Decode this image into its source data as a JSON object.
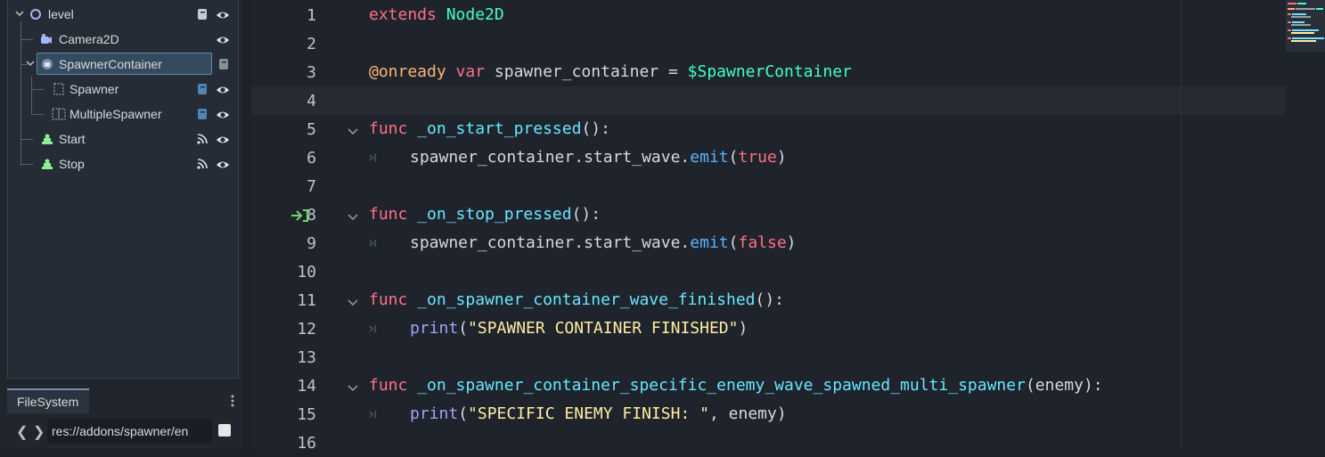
{
  "scene_tree": {
    "nodes": [
      {
        "label": "level",
        "icon": "node2d-circle-icon"
      },
      {
        "label": "Camera2D",
        "icon": "camera2d-icon"
      },
      {
        "label": "SpawnerContainer",
        "icon": "spawner-container-icon"
      },
      {
        "label": "Spawner",
        "icon": "spawner-icon"
      },
      {
        "label": "MultipleSpawner",
        "icon": "multiple-spawner-icon"
      },
      {
        "label": "Start",
        "icon": "button-node-icon"
      },
      {
        "label": "Stop",
        "icon": "button-node-icon"
      }
    ]
  },
  "filesystem": {
    "tab_label": "FileSystem",
    "path_value": "res://addons/spawner/en",
    "back_glyph": "❮",
    "forward_glyph": "❯"
  },
  "editor": {
    "lines": [
      {
        "n": "1",
        "tokens": [
          [
            "kw",
            "extends"
          ],
          [
            "p",
            " "
          ],
          [
            "cls",
            "Node2D"
          ]
        ]
      },
      {
        "n": "2",
        "tokens": []
      },
      {
        "n": "3",
        "tokens": [
          [
            "ann",
            "@onready"
          ],
          [
            "p",
            " "
          ],
          [
            "kw",
            "var"
          ],
          [
            "p",
            " spawner_container = "
          ],
          [
            "cls",
            "$SpawnerContainer"
          ]
        ]
      },
      {
        "n": "4",
        "tokens": []
      },
      {
        "n": "5",
        "tokens": [
          [
            "kw",
            "func"
          ],
          [
            "p",
            " "
          ],
          [
            "fnd",
            "_on_start_pressed"
          ],
          [
            "p",
            "():"
          ]
        ]
      },
      {
        "n": "6",
        "tokens": [
          [
            "p",
            "spawner_container.start_wave."
          ],
          [
            "fn",
            "emit"
          ],
          [
            "p",
            "("
          ],
          [
            "kw",
            "true"
          ],
          [
            "p",
            ")"
          ]
        ]
      },
      {
        "n": "7",
        "tokens": []
      },
      {
        "n": "8",
        "tokens": [
          [
            "kw",
            "func"
          ],
          [
            "p",
            " "
          ],
          [
            "fnd",
            "_on_stop_pressed"
          ],
          [
            "p",
            "():"
          ]
        ]
      },
      {
        "n": "9",
        "tokens": [
          [
            "p",
            "spawner_container.start_wave."
          ],
          [
            "fn",
            "emit"
          ],
          [
            "p",
            "("
          ],
          [
            "kw",
            "false"
          ],
          [
            "p",
            ")"
          ]
        ]
      },
      {
        "n": "10",
        "tokens": []
      },
      {
        "n": "11",
        "tokens": [
          [
            "kw",
            "func"
          ],
          [
            "p",
            " "
          ],
          [
            "fnd",
            "_on_spawner_container_wave_finished"
          ],
          [
            "p",
            "():"
          ]
        ]
      },
      {
        "n": "12",
        "tokens": [
          [
            "bi",
            "print"
          ],
          [
            "p",
            "("
          ],
          [
            "str",
            "\"SPAWNER CONTAINER FINISHED\""
          ],
          [
            "p",
            ")"
          ]
        ]
      },
      {
        "n": "13",
        "tokens": []
      },
      {
        "n": "14",
        "tokens": [
          [
            "kw",
            "func"
          ],
          [
            "p",
            " "
          ],
          [
            "fnd",
            "_on_spawner_container_specific_enemy_wave_spawned_multi_spawner"
          ],
          [
            "p",
            "(enemy):"
          ]
        ]
      },
      {
        "n": "15",
        "tokens": [
          [
            "bi",
            "print"
          ],
          [
            "p",
            "("
          ],
          [
            "str",
            "\"SPECIFIC ENEMY FINISH: \""
          ],
          [
            "p",
            ", enemy)"
          ]
        ]
      },
      {
        "n": "16",
        "tokens": []
      }
    ],
    "current_line": "4",
    "colors": {
      "keyword": "#ff7085",
      "class": "#42ffc2",
      "function": "#57b3ff",
      "string": "#ffeda1",
      "connected_signal": "#6fd66f"
    }
  }
}
